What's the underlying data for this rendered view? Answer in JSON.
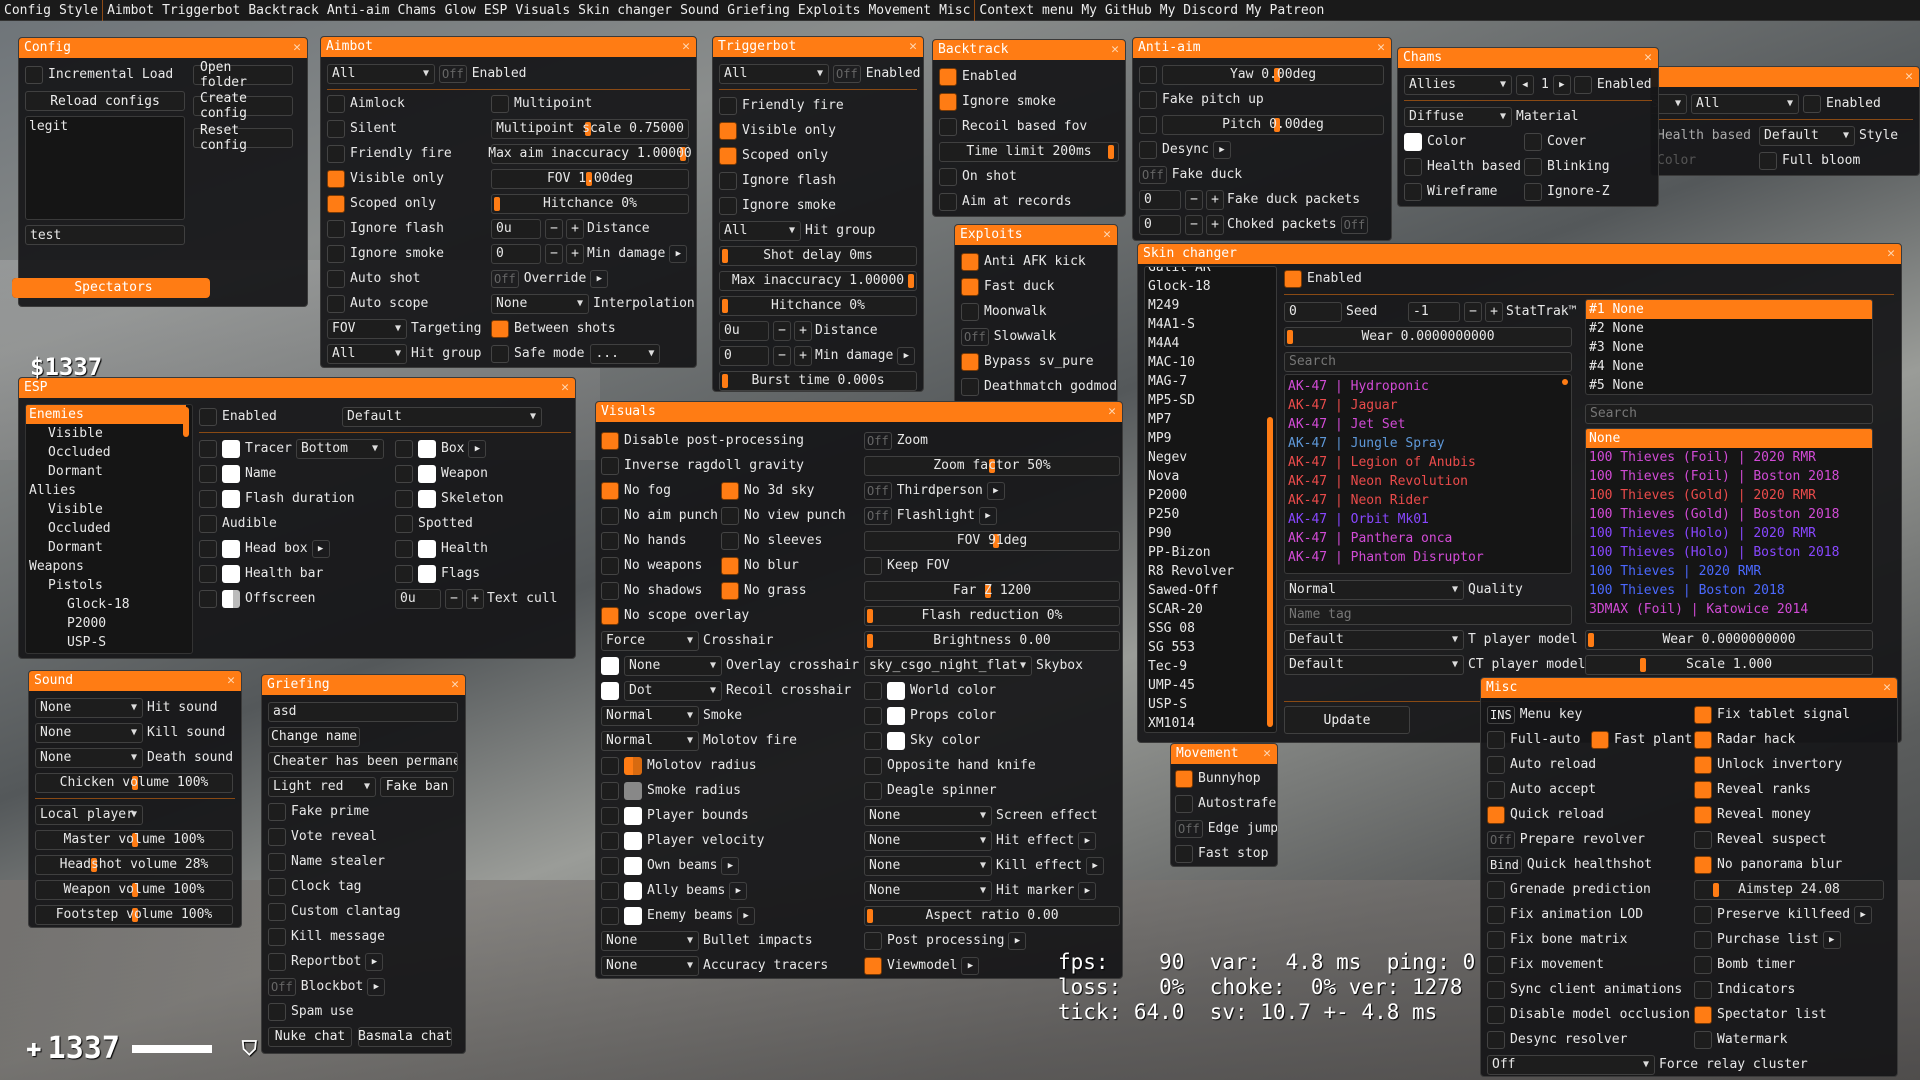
{
  "menu_bar": [
    "Config",
    "Style",
    "Aimbot",
    "Triggerbot",
    "Backtrack",
    "Anti-aim",
    "Chams",
    "Glow",
    "ESP",
    "Visuals",
    "Skin changer",
    "Sound",
    "Griefing",
    "Exploits",
    "Movement",
    "Misc",
    "Context menu",
    "My GitHub",
    "My Discord",
    "My Patreon"
  ],
  "accent": "#ff7c14",
  "config": {
    "title": "Config",
    "incremental_load": "Incremental Load",
    "reload": "Reload configs",
    "open_folder": "Open folder",
    "create": "Create config",
    "reset": "Reset config",
    "configs": [
      "legit"
    ],
    "name_field": "test",
    "spectators": "Spectators"
  },
  "aimbot": {
    "title": "Aimbot",
    "weapon": "All",
    "enabled_key": "Off",
    "enabled": "Enabled",
    "left": [
      {
        "l": "Aimlock",
        "on": false
      },
      {
        "l": "Silent",
        "on": false
      },
      {
        "l": "Friendly fire",
        "on": false
      },
      {
        "l": "Visible only",
        "on": true
      },
      {
        "l": "Scoped only",
        "on": true
      },
      {
        "l": "Ignore flash",
        "on": false
      },
      {
        "l": "Ignore smoke",
        "on": false
      },
      {
        "l": "Auto shot",
        "on": false
      },
      {
        "l": "Auto scope",
        "on": false
      }
    ],
    "multipoint": "Multipoint",
    "multipoint_scale": "Multipoint scale 0.75000",
    "max_aim_inacc": "Max aim inaccuracy 1.00000",
    "fov": "FOV 1.00deg",
    "hitchance": "Hitchance 0%",
    "distance_val": "0u",
    "distance": "Distance",
    "min_damage_val": "0",
    "min_damage": "Min damage",
    "override_key": "Off",
    "override": "Override",
    "interp_val": "None",
    "interpolation": "Interpolation",
    "targeting_val": "FOV",
    "targeting": "Targeting",
    "between_shots": "Between shots",
    "hitgroup_val": "All",
    "hitgroup": "Hit group",
    "safe_mode": "Safe mode",
    "safe_mode_val": "..."
  },
  "triggerbot": {
    "title": "Triggerbot",
    "weapon": "All",
    "enabled_key": "Off",
    "enabled": "Enabled",
    "checks": [
      {
        "l": "Friendly fire",
        "on": false
      },
      {
        "l": "Visible only",
        "on": true
      },
      {
        "l": "Scoped only",
        "on": true
      },
      {
        "l": "Ignore flash",
        "on": false
      },
      {
        "l": "Ignore smoke",
        "on": false
      }
    ],
    "hitgroup_val": "All",
    "hitgroup": "Hit group",
    "shot_delay": "Shot delay 0ms",
    "max_inacc": "Max inaccuracy 1.00000",
    "hitchance": "Hitchance 0%",
    "distance_val": "0u",
    "distance": "Distance",
    "min_damage_val": "0",
    "min_damage": "Min damage",
    "burst": "Burst time 0.000s"
  },
  "backtrack": {
    "title": "Backtrack",
    "checks": [
      {
        "l": "Enabled",
        "on": true
      },
      {
        "l": "Ignore smoke",
        "on": true
      },
      {
        "l": "Recoil based fov",
        "on": false
      }
    ],
    "time_limit": "Time limit 200ms",
    "checks2": [
      {
        "l": "On shot",
        "on": false
      },
      {
        "l": "Aim at records",
        "on": false
      }
    ]
  },
  "antiaim": {
    "title": "Anti-aim",
    "yaw": "Yaw 0.00deg",
    "fake_pitch": "Fake pitch up",
    "pitch": "Pitch 0.00deg",
    "desync": "Desync",
    "fake_duck_key": "Off",
    "fake_duck": "Fake duck",
    "fd_packets_val": "0",
    "fd_packets": "Fake duck packets",
    "choked_val": "0",
    "choked": "Choked packets",
    "choked_key": "Off"
  },
  "chams": {
    "title": "Chams",
    "category": "Allies",
    "page": "1",
    "enabled": "Enabled",
    "material_val": "Diffuse",
    "material": "Material",
    "checks": [
      {
        "l": "Color",
        "swatch": true
      },
      {
        "l": "Cover",
        "on": false
      },
      {
        "l": "Health based",
        "on": false
      },
      {
        "l": "Blinking",
        "on": false
      },
      {
        "l": "Wireframe",
        "on": false
      },
      {
        "l": "Ignore-Z",
        "on": false
      }
    ]
  },
  "glow": {
    "category": "Allies",
    "sub": "All",
    "enabled": "Enabled",
    "health_based": "Health based",
    "style_val": "Default",
    "style": "Style",
    "color": "Color",
    "full_bloom": "Full bloom"
  },
  "exploits": {
    "title": "Exploits",
    "items": [
      {
        "l": "Anti AFK kick",
        "on": true
      },
      {
        "l": "Fast duck",
        "on": true
      },
      {
        "l": "Moonwalk",
        "on": false
      },
      {
        "l": "Slowwalk",
        "key": "Off"
      },
      {
        "l": "Bypass sv_pure",
        "on": true
      },
      {
        "l": "Deathmatch godmode",
        "on": false
      }
    ]
  },
  "esp": {
    "title": "ESP",
    "tree": [
      {
        "l": "Enemies",
        "d": 0,
        "sel": true
      },
      {
        "l": "Visible",
        "d": 1
      },
      {
        "l": "Occluded",
        "d": 1
      },
      {
        "l": "Dormant",
        "d": 1
      },
      {
        "l": "Allies",
        "d": 0
      },
      {
        "l": "Visible",
        "d": 1
      },
      {
        "l": "Occluded",
        "d": 1
      },
      {
        "l": "Dormant",
        "d": 1
      },
      {
        "l": "Weapons",
        "d": 0
      },
      {
        "l": "Pistols",
        "d": 1
      },
      {
        "l": "Glock-18",
        "d": 2
      },
      {
        "l": "P2000",
        "d": 2
      },
      {
        "l": "USP-S",
        "d": 2
      }
    ],
    "enabled": "Enabled",
    "font": "Default",
    "tracer": "Tracer",
    "tracer_val": "Bottom",
    "box": "Box",
    "name": "Name",
    "weapon": "Weapon",
    "flash": "Flash duration",
    "skeleton": "Skeleton",
    "audible": "Audible",
    "spotted": "Spotted",
    "head_box": "Head box",
    "health": "Health",
    "health_bar": "Health bar",
    "flags": "Flags",
    "offscreen": "Offscreen",
    "text_cull_val": "0u",
    "text_cull": "Text cull"
  },
  "visuals": {
    "title": "Visuals",
    "disable_pp": "Disable post-processing",
    "inverse_ragdoll": "Inverse ragdoll gravity",
    "pairs": [
      [
        {
          "l": "No fog",
          "on": true
        },
        {
          "l": "No 3d sky",
          "on": true
        }
      ],
      [
        {
          "l": "No aim punch",
          "on": false
        },
        {
          "l": "No view punch",
          "on": false
        }
      ],
      [
        {
          "l": "No hands",
          "on": false
        },
        {
          "l": "No sleeves",
          "on": false
        }
      ],
      [
        {
          "l": "No weapons",
          "on": false
        },
        {
          "l": "No blur",
          "on": true
        }
      ],
      [
        {
          "l": "No shadows",
          "on": false
        },
        {
          "l": "No grass",
          "on": true
        }
      ]
    ],
    "no_scope": "No scope overlay",
    "crosshair_val": "Force",
    "crosshair": "Crosshair",
    "overlay_val": "None",
    "overlay": "Overlay crosshair",
    "recoil_val": "Dot",
    "recoil": "Recoil crosshair",
    "smoke_val": "Normal",
    "smoke": "Smoke",
    "molotov_val": "Normal",
    "molotov": "Molotov fire",
    "left_colors": [
      {
        "l": "Molotov radius"
      },
      {
        "l": "Smoke radius"
      },
      {
        "l": "Player bounds"
      },
      {
        "l": "Player velocity"
      },
      {
        "l": "Own beams",
        "arr": true
      },
      {
        "l": "Ally beams",
        "arr": true
      },
      {
        "l": "Enemy beams",
        "arr": true
      }
    ],
    "bullet_val": "None",
    "bullet": "Bullet impacts",
    "acc_val": "None",
    "acc": "Accuracy tracers",
    "zoom_key": "Off",
    "zoom": "Zoom",
    "zoom_factor": "Zoom factor 50%",
    "third_key": "Off",
    "thirdperson": "Thirdperson",
    "flash_key": "Off",
    "flashlight": "Flashlight",
    "fov": "FOV 91deg",
    "keep_fov": "Keep FOV",
    "far": "Far Z 1200",
    "flash_red": "Flash reduction 0%",
    "brightness": "Brightness 0.00",
    "skybox_val": "sky_csgo_night_flat",
    "skybox": "Skybox",
    "world_color": "World color",
    "props_color": "Props color",
    "sky_color": "Sky color",
    "opp_knife": "Opposite hand knife",
    "deagle": "Deagle spinner",
    "effects": [
      {
        "v": "None",
        "l": "Screen effect"
      },
      {
        "v": "None",
        "l": "Hit effect",
        "arr": true
      },
      {
        "v": "None",
        "l": "Kill effect",
        "arr": true
      },
      {
        "v": "None",
        "l": "Hit marker",
        "arr": true
      }
    ],
    "aspect": "Aspect ratio 0.00",
    "post": "Post processing",
    "viewmodel": "Viewmodel"
  },
  "skin": {
    "title": "Skin changer",
    "weapons": [
      "Galil AR",
      "Glock-18",
      "M249",
      "M4A1-S",
      "M4A4",
      "MAC-10",
      "MAG-7",
      "MP5-SD",
      "MP7",
      "MP9",
      "Negev",
      "Nova",
      "P2000",
      "P250",
      "P90",
      "PP-Bizon",
      "R8 Revolver",
      "Sawed-Off",
      "SCAR-20",
      "SSG 08",
      "SG 553",
      "Tec-9",
      "UMP-45",
      "USP-S",
      "XM1014"
    ],
    "enabled": "Enabled",
    "seed_val": "0",
    "seed": "Seed",
    "stattrak_val": "-1",
    "stattrak": "StatTrak™",
    "wear": "Wear 0.0000000000",
    "search_ph": "Search",
    "skins": [
      {
        "w": "AK-47",
        "n": "Hydroponic",
        "c": "#d24bd6"
      },
      {
        "w": "AK-47",
        "n": "Jaguar",
        "c": "#eb4b4b"
      },
      {
        "w": "AK-47",
        "n": "Jet Set",
        "c": "#d24bd6"
      },
      {
        "w": "AK-47",
        "n": "Jungle Spray",
        "c": "#5e98d9"
      },
      {
        "w": "AK-47",
        "n": "Legion of Anubis",
        "c": "#eb4b4b"
      },
      {
        "w": "AK-47",
        "n": "Neon Revolution",
        "c": "#eb4b4b"
      },
      {
        "w": "AK-47",
        "n": "Neon Rider",
        "c": "#eb4b4b"
      },
      {
        "w": "AK-47",
        "n": "Orbit Mk01",
        "c": "#8847ff"
      },
      {
        "w": "AK-47",
        "n": "Panthera onca",
        "c": "#d24bd6"
      },
      {
        "w": "AK-47",
        "n": "Phantom Disruptor",
        "c": "#d24bd6"
      }
    ],
    "quality_val": "Normal",
    "quality": "Quality",
    "name_tag_ph": "Name tag",
    "t_model_val": "Default",
    "t_model": "T player model",
    "ct_model_val": "Default",
    "ct_model": "CT player model",
    "update": "Update",
    "sticker_slots": [
      "#1 None",
      "#2 None",
      "#3 None",
      "#4 None",
      "#5 None"
    ],
    "sticker_search_ph": "Search",
    "stickers": [
      {
        "t": "None",
        "c": "#eee",
        "sel": true
      },
      {
        "t": "100 Thieves (Foil) | 2020 RMR",
        "c": "#d24bd6"
      },
      {
        "t": "100 Thieves (Foil) | Boston 2018",
        "c": "#d24bd6"
      },
      {
        "t": "100 Thieves (Gold) | 2020 RMR",
        "c": "#eb4b4b"
      },
      {
        "t": "100 Thieves (Gold) | Boston 2018",
        "c": "#d24bd6"
      },
      {
        "t": "100 Thieves (Holo) | 2020 RMR",
        "c": "#8847ff"
      },
      {
        "t": "100 Thieves (Holo) | Boston 2018",
        "c": "#8847ff"
      },
      {
        "t": "100 Thieves | 2020 RMR",
        "c": "#4b69ff"
      },
      {
        "t": "100 Thieves | Boston 2018",
        "c": "#4b69ff"
      },
      {
        "t": "3DMAX (Foil) | Katowice 2014",
        "c": "#d24bd6"
      }
    ],
    "sticker_wear": "Wear 0.0000000000",
    "sticker_scale": "Scale 1.000"
  },
  "sound": {
    "title": "Sound",
    "rows": [
      {
        "v": "None",
        "l": "Hit sound"
      },
      {
        "v": "None",
        "l": "Kill sound"
      },
      {
        "v": "None",
        "l": "Death sound"
      }
    ],
    "chicken": "Chicken volume 100%",
    "player_val": "Local player",
    "volumes": [
      {
        "l": "Master volume 100%",
        "p": 0.5
      },
      {
        "l": "Headshot volume 28%",
        "p": 0.28
      },
      {
        "l": "Weapon volume 100%",
        "p": 0.5
      },
      {
        "l": "Footstep volume 100%",
        "p": 0.5
      }
    ]
  },
  "griefing": {
    "title": "Griefing",
    "name_input": "asd",
    "change_name": "Change name",
    "ban_text": "Cheater has been permanentl",
    "ban_color": "Light red",
    "fake_ban": "Fake ban",
    "checks": [
      {
        "l": "Fake prime"
      },
      {
        "l": "Vote reveal"
      },
      {
        "l": "Name stealer"
      },
      {
        "l": "Clock tag"
      },
      {
        "l": "Custom clantag"
      },
      {
        "l": "Kill message"
      },
      {
        "l": "Reportbot",
        "arr": true
      },
      {
        "l": "Blockbot",
        "key": "Off",
        "arr": true
      },
      {
        "l": "Spam use"
      }
    ],
    "nuke": "Nuke chat",
    "basmala": "Basmala chat"
  },
  "movement": {
    "title": "Movement",
    "items": [
      {
        "l": "Bunnyhop",
        "on": true
      },
      {
        "l": "Autostrafe",
        "on": false
      },
      {
        "l": "Edge jump",
        "key": "Off"
      },
      {
        "l": "Fast stop",
        "on": false
      }
    ]
  },
  "misc": {
    "title": "Misc",
    "left": [
      {
        "l": "Menu key",
        "key": "INS"
      },
      {
        "l": "Full-auto",
        "on": false
      },
      {
        "l": "Auto reload",
        "on": false
      },
      {
        "l": "Auto accept",
        "on": false
      },
      {
        "l": "Quick reload",
        "on": true
      },
      {
        "l": "Prepare revolver",
        "key": "Off"
      },
      {
        "l": "Quick healthshot",
        "key": "Bind"
      },
      {
        "l": "Grenade prediction",
        "on": false
      },
      {
        "l": "Fix animation LOD",
        "on": false
      },
      {
        "l": "Fix bone matrix",
        "on": false
      },
      {
        "l": "Fix movement",
        "on": false
      },
      {
        "l": "Sync client animations",
        "on": false
      },
      {
        "l": "Disable model occlusion",
        "on": false
      },
      {
        "l": "Desync resolver",
        "on": false
      }
    ],
    "fast_plant": "Fast plant",
    "right": [
      {
        "l": "Fix tablet signal",
        "on": true
      },
      {
        "l": "Radar hack",
        "on": true
      },
      {
        "l": "Unlock invertory",
        "on": true
      },
      {
        "l": "Reveal ranks",
        "on": true
      },
      {
        "l": "Reveal money",
        "on": true
      },
      {
        "l": "Reveal suspect",
        "on": false
      },
      {
        "l": "No panorama blur",
        "on": true
      },
      {
        "slider": "Aimstep 24.08"
      },
      {
        "l": "Preserve killfeed",
        "on": false,
        "arr": true
      },
      {
        "l": "Purchase list",
        "on": false,
        "arr": true
      },
      {
        "l": "Bomb timer",
        "on": false
      },
      {
        "l": "Indicators",
        "on": false
      },
      {
        "l": "Spectator list",
        "on": true
      },
      {
        "l": "Watermark",
        "on": false
      }
    ],
    "relay_val": "Off",
    "relay": "Force relay cluster"
  },
  "hud": {
    "netgraph": "fps:    90  var:  4.8 ms  ping: 0\nloss:   0%  choke:  0% ver: 1278\ntick: 64.0  sv: 10.7 +- 4.8 ms",
    "health": "1337",
    "armor": "100",
    "money": "$1337"
  }
}
